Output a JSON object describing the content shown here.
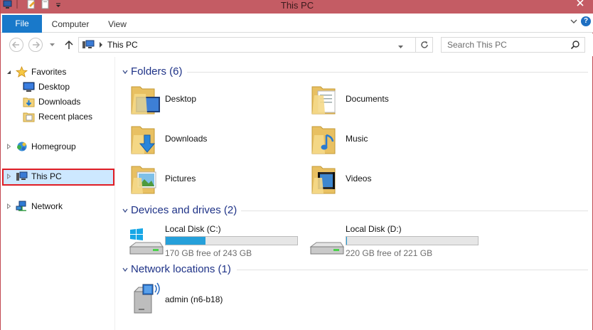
{
  "window": {
    "title": "This PC"
  },
  "ribbon": {
    "tabs": [
      {
        "label": "File",
        "active": true
      },
      {
        "label": "Computer",
        "active": false
      },
      {
        "label": "View",
        "active": false
      }
    ],
    "help_label": "?"
  },
  "navigation": {
    "address_path": "This PC",
    "search_placeholder": "Search This PC"
  },
  "sidebar": {
    "items": [
      {
        "label": "Favorites",
        "icon": "star-icon"
      },
      {
        "label": "Desktop",
        "icon": "desktop-icon"
      },
      {
        "label": "Downloads",
        "icon": "downloads-icon"
      },
      {
        "label": "Recent places",
        "icon": "recent-places-icon"
      },
      {
        "label": "Homegroup",
        "icon": "homegroup-icon"
      },
      {
        "label": "This PC",
        "icon": "computer-icon",
        "selected": true
      },
      {
        "label": "Network",
        "icon": "network-icon"
      }
    ]
  },
  "content": {
    "folders_header": "Folders (6)",
    "folders": [
      {
        "label": "Desktop",
        "icon": "desktop-folder-icon"
      },
      {
        "label": "Documents",
        "icon": "documents-folder-icon"
      },
      {
        "label": "Downloads",
        "icon": "downloads-folder-icon"
      },
      {
        "label": "Music",
        "icon": "music-folder-icon"
      },
      {
        "label": "Pictures",
        "icon": "pictures-folder-icon"
      },
      {
        "label": "Videos",
        "icon": "videos-folder-icon"
      }
    ],
    "drives_header": "Devices and drives (2)",
    "drives": [
      {
        "name": "Local Disk (C:)",
        "free_text": "170 GB free of 243 GB",
        "used_fraction": 0.3,
        "icon": "windows-drive-icon"
      },
      {
        "name": "Local Disk (D:)",
        "free_text": "220 GB free of 221 GB",
        "used_fraction": 0.005,
        "icon": "hard-drive-icon"
      }
    ],
    "network_header": "Network locations (1)",
    "network_locations": [
      {
        "label": "admin (n6-b18)",
        "icon": "network-drive-icon"
      }
    ]
  },
  "colors": {
    "title_bar": "#c45c64",
    "file_tab": "#1979ca",
    "group_header_text": "#1e3287",
    "drive_bar_fill": "#26a0da",
    "selection_outline": "#e01d25",
    "selection_fill": "#cde8ff"
  }
}
